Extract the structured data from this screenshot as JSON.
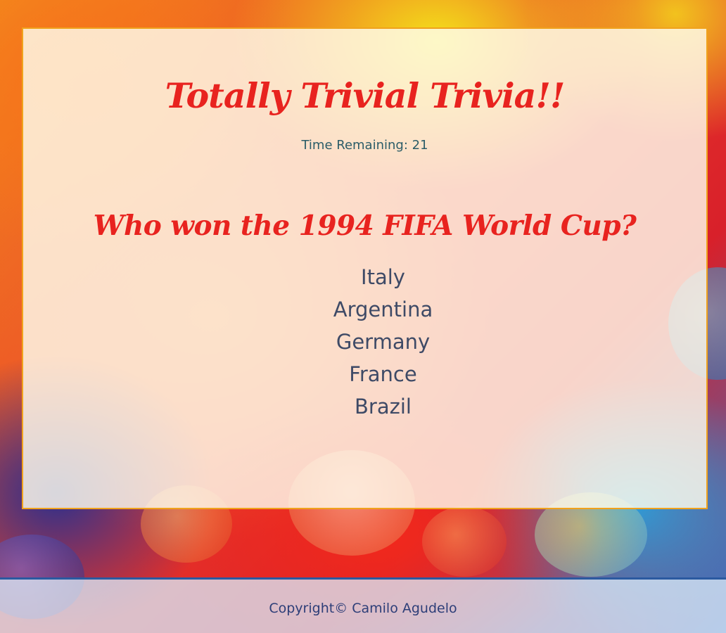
{
  "app": {
    "title": "Totally Trivial Trivia!!"
  },
  "timer": {
    "label": "Time Remaining:",
    "value": "21"
  },
  "question": {
    "text": "Who won the 1994 FIFA World Cup?",
    "answers": [
      "Italy",
      "Argentina",
      "Germany",
      "France",
      "Brazil"
    ]
  },
  "footer": {
    "copyright": "Copyright© Camilo Agudelo"
  },
  "colors": {
    "accent": "#e8231f",
    "panel_border": "#f0a21c",
    "answer_text": "#3e4a66",
    "footer_border": "#2b5aa0"
  }
}
